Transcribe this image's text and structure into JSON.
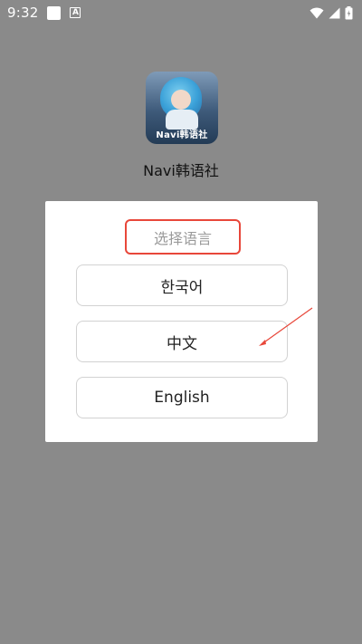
{
  "status_bar": {
    "time": "9:32",
    "icons": [
      "notification-square-icon",
      "notification-a-icon",
      "wifi-icon",
      "signal-icon",
      "battery-icon"
    ]
  },
  "app": {
    "icon_caption": "Navi韩语社",
    "name": "Navi韩语社"
  },
  "dialog": {
    "title": "选择语言",
    "options": [
      {
        "label": "한국어"
      },
      {
        "label": "中文"
      },
      {
        "label": "English"
      }
    ]
  },
  "colors": {
    "background_overlay": "#8a8a8a",
    "highlight_border": "#e8473a",
    "arrow": "#e8473a"
  }
}
